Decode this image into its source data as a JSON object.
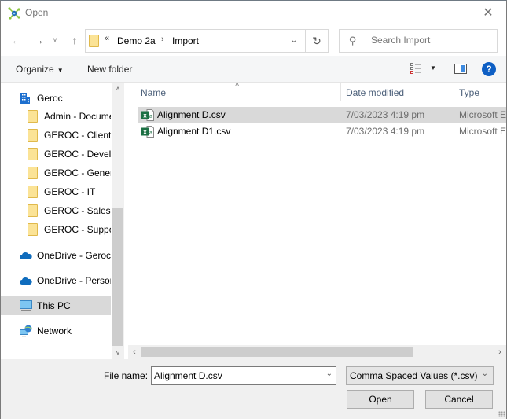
{
  "window": {
    "title": "Open",
    "close_glyph": "✕"
  },
  "navigation": {
    "back_glyph": "←",
    "forward_glyph": "→",
    "recent_glyph": "˅",
    "up_glyph": "↑",
    "address": {
      "overflow_glyph": "«",
      "breadcrumbs": [
        "Demo 2a",
        "Import"
      ],
      "separator_glyph": "›",
      "dropdown_glyph": "⌄",
      "refresh_glyph": "↻"
    },
    "search": {
      "placeholder": "Search Import",
      "value": "",
      "icon": "search-icon",
      "icon_glyph": "⚲"
    }
  },
  "toolbar": {
    "organize_label": "Organize",
    "caret_glyph": "▼",
    "new_folder_label": "New folder",
    "help_glyph": "?"
  },
  "sidebar": {
    "items": [
      {
        "label": "Geroc",
        "icon": "building-icon",
        "selected": false
      },
      {
        "label": "Admin - Documents",
        "icon": "folder-icon",
        "selected": false
      },
      {
        "label": "GEROC - Clients",
        "icon": "folder-icon",
        "selected": false
      },
      {
        "label": "GEROC - Development",
        "icon": "folder-icon",
        "selected": false
      },
      {
        "label": "GEROC - General",
        "icon": "folder-icon",
        "selected": false
      },
      {
        "label": "GEROC - IT",
        "icon": "folder-icon",
        "selected": false
      },
      {
        "label": "GEROC - Sales",
        "icon": "folder-icon",
        "selected": false
      },
      {
        "label": "GEROC - Support",
        "icon": "folder-icon",
        "selected": false
      },
      {
        "label": "OneDrive - Geroc",
        "icon": "cloud-icon",
        "selected": false
      },
      {
        "label": "OneDrive - Personal",
        "icon": "cloud-icon",
        "selected": false
      },
      {
        "label": "This PC",
        "icon": "computer-icon",
        "selected": true
      },
      {
        "label": "Network",
        "icon": "network-icon",
        "selected": false
      }
    ],
    "scroll_up_glyph": "˄",
    "scroll_down_glyph": "˅"
  },
  "filelist": {
    "sort_glyph": "˄",
    "columns": [
      "Name",
      "Date modified",
      "Type"
    ],
    "rows": [
      {
        "name": "Alignment D.csv",
        "date": "7/03/2023 4:19 pm",
        "type": "Microsoft Excel Comma Separated Values File",
        "selected": true
      },
      {
        "name": "Alignment D1.csv",
        "date": "7/03/2023 4:19 pm",
        "type": "Microsoft Excel Comma Separated Values File",
        "selected": false
      }
    ],
    "hscroll_left_glyph": "‹",
    "hscroll_right_glyph": "›"
  },
  "footer": {
    "file_name_label": "File name:",
    "file_name_value": "Alignment D.csv",
    "dropdown_glyph": "⌄",
    "file_type_selected": "Comma Spaced Values (*.csv)",
    "open_label": "Open",
    "cancel_label": "Cancel"
  },
  "colors": {
    "accent_blue": "#0e5fc4",
    "selection_gray": "#d9d9d9",
    "folder_yellow": "#fbe396",
    "excel_green": "#1d7044"
  }
}
